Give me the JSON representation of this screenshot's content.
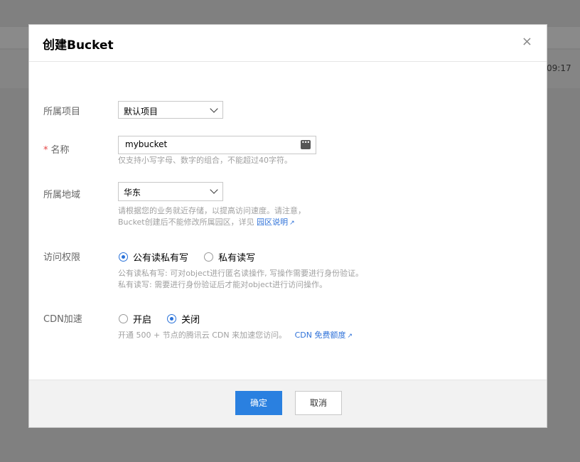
{
  "background": {
    "time_fragment": "09:17"
  },
  "dialog": {
    "title": "创建Bucket",
    "close_symbol": "×",
    "project": {
      "label": "所属项目",
      "value": "默认项目"
    },
    "name": {
      "required_mark": "*",
      "label": "名称",
      "value": "mybucket",
      "help": "仅支持小写字母、数字的组合，不能超过40字符。"
    },
    "region": {
      "label": "所属地域",
      "value": "华东",
      "help_line1": "请根据您的业务就近存储，以提高访问速度。请注意，",
      "help_line2": "Bucket创建后不能修改所属园区，详见",
      "help_link": "园区说明"
    },
    "access": {
      "label": "访问权限",
      "options": [
        {
          "label": "公有读私有写",
          "selected": true
        },
        {
          "label": "私有读写",
          "selected": false
        }
      ],
      "help_line1": "公有读私有写: 可对object进行匿名读操作, 写操作需要进行身份验证。",
      "help_line2": "私有读写: 需要进行身份验证后才能对object进行访问操作。"
    },
    "cdn": {
      "label": "CDN加速",
      "options": [
        {
          "label": "开启",
          "selected": false
        },
        {
          "label": "关闭",
          "selected": true
        }
      ],
      "help": "开通 500 + 节点的腾讯云 CDN 来加速您访问。",
      "help_link": "CDN 免费额度"
    },
    "footer": {
      "ok_label": "确定",
      "cancel_label": "取消"
    }
  },
  "colors": {
    "primary": "#2a80e0",
    "link": "#2f72d9",
    "required": "#e54545"
  }
}
